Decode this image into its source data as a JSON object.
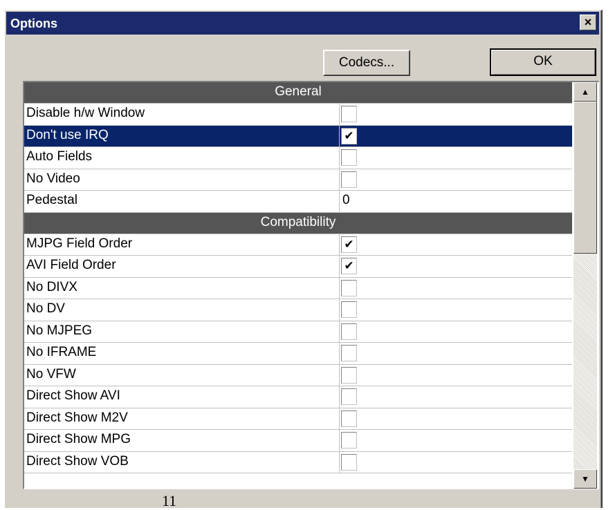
{
  "window": {
    "title": "Options",
    "close_label": "×"
  },
  "buttons": {
    "codecs_label": "Codecs...",
    "ok_label": "OK"
  },
  "sections": [
    {
      "title": "General",
      "rows": [
        {
          "label": "Disable h/w Window",
          "type": "checkbox",
          "checked": false,
          "selected": false
        },
        {
          "label": "Don't use IRQ",
          "type": "checkbox",
          "checked": true,
          "selected": true
        },
        {
          "label": "Auto Fields",
          "type": "checkbox",
          "checked": false,
          "selected": false
        },
        {
          "label": "No Video",
          "type": "checkbox",
          "checked": false,
          "selected": false
        },
        {
          "label": "Pedestal",
          "type": "value",
          "value": "0",
          "selected": false
        }
      ]
    },
    {
      "title": "Compatibility",
      "rows": [
        {
          "label": "MJPG Field Order",
          "type": "checkbox",
          "checked": true,
          "selected": false
        },
        {
          "label": "AVI Field Order",
          "type": "checkbox",
          "checked": true,
          "selected": false
        },
        {
          "label": "No DIVX",
          "type": "checkbox",
          "checked": false,
          "selected": false
        },
        {
          "label": "No DV",
          "type": "checkbox",
          "checked": false,
          "selected": false
        },
        {
          "label": "No MJPEG",
          "type": "checkbox",
          "checked": false,
          "selected": false
        },
        {
          "label": "No IFRAME",
          "type": "checkbox",
          "checked": false,
          "selected": false
        },
        {
          "label": "No VFW",
          "type": "checkbox",
          "checked": false,
          "selected": false
        },
        {
          "label": "Direct Show AVI",
          "type": "checkbox",
          "checked": false,
          "selected": false
        },
        {
          "label": "Direct Show M2V",
          "type": "checkbox",
          "checked": false,
          "selected": false
        },
        {
          "label": "Direct Show MPG",
          "type": "checkbox",
          "checked": false,
          "selected": false
        },
        {
          "label": "Direct Show VOB",
          "type": "checkbox",
          "checked": false,
          "selected": false
        }
      ]
    }
  ],
  "scrollbar": {
    "up_icon": "▲",
    "down_icon": "▼"
  },
  "colors": {
    "titlebar": "#1a2a6c",
    "selection": "#0a246a",
    "section_header": "#555555"
  },
  "footer": {
    "page_number": "11"
  }
}
